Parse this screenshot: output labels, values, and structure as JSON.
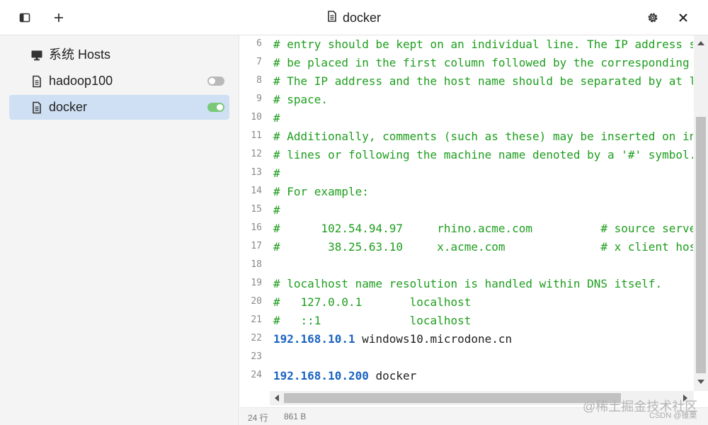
{
  "titlebar": {
    "title": "docker",
    "icons": {
      "sidebar_toggle": "sidebar-panel-icon",
      "add": "plus-icon",
      "doc": "document-icon",
      "settings": "gear-icon",
      "close": "close-icon"
    }
  },
  "sidebar": {
    "items": [
      {
        "label": "系统 Hosts",
        "icon": "monitor-icon",
        "toggle": null,
        "active": false
      },
      {
        "label": "hadoop100",
        "icon": "document-icon",
        "toggle": "off",
        "active": false
      },
      {
        "label": "docker",
        "icon": "document-icon",
        "toggle": "on",
        "active": true
      }
    ]
  },
  "editor": {
    "lines": [
      {
        "n": "6",
        "segments": [
          {
            "t": "# entry should be kept on an individual line. The IP address s",
            "c": "comment"
          }
        ]
      },
      {
        "n": "7",
        "segments": [
          {
            "t": "# be placed in the first column followed by the corresponding",
            "c": "comment"
          }
        ]
      },
      {
        "n": "8",
        "segments": [
          {
            "t": "# The IP address and the host name should be separated by at l",
            "c": "comment"
          }
        ]
      },
      {
        "n": "9",
        "segments": [
          {
            "t": "# space.",
            "c": "comment"
          }
        ]
      },
      {
        "n": "10",
        "segments": [
          {
            "t": "#",
            "c": "comment"
          }
        ]
      },
      {
        "n": "11",
        "segments": [
          {
            "t": "# Additionally, comments (such as these) may be inserted on in",
            "c": "comment"
          }
        ]
      },
      {
        "n": "12",
        "segments": [
          {
            "t": "# lines or following the machine name denoted by a '#' symbol.",
            "c": "comment"
          }
        ]
      },
      {
        "n": "13",
        "segments": [
          {
            "t": "#",
            "c": "comment"
          }
        ]
      },
      {
        "n": "14",
        "segments": [
          {
            "t": "# For example:",
            "c": "comment"
          }
        ]
      },
      {
        "n": "15",
        "segments": [
          {
            "t": "#",
            "c": "comment"
          }
        ]
      },
      {
        "n": "16",
        "segments": [
          {
            "t": "#      102.54.94.97     rhino.acme.com          # source serve",
            "c": "comment"
          }
        ]
      },
      {
        "n": "17",
        "segments": [
          {
            "t": "#       38.25.63.10     x.acme.com              # x client hos",
            "c": "comment"
          }
        ]
      },
      {
        "n": "18",
        "segments": []
      },
      {
        "n": "19",
        "segments": [
          {
            "t": "# localhost name resolution is handled within DNS itself.",
            "c": "comment"
          }
        ]
      },
      {
        "n": "20",
        "segments": [
          {
            "t": "#   127.0.0.1       localhost",
            "c": "comment"
          }
        ]
      },
      {
        "n": "21",
        "segments": [
          {
            "t": "#   ::1             localhost",
            "c": "comment"
          }
        ]
      },
      {
        "n": "22",
        "segments": [
          {
            "t": "192.168.10.1",
            "c": "ip"
          },
          {
            "t": " windows10.microdone.cn",
            "c": "host"
          }
        ]
      },
      {
        "n": "23",
        "segments": []
      },
      {
        "n": "24",
        "segments": [
          {
            "t": "192.168.10.200",
            "c": "ip"
          },
          {
            "t": " docker",
            "c": "host"
          }
        ]
      }
    ]
  },
  "statusbar": {
    "lines": "24 行",
    "size": "861 B"
  },
  "watermark": {
    "main": "@稀土掘金技术社区",
    "sub": "CSDN @锥栗"
  },
  "colors": {
    "comment": "#1e9e1e",
    "ip": "#1a63c2",
    "active_item": "#cfe0f4",
    "toggle_on": "#7ac97a",
    "toggle_off": "#b9b9b9"
  }
}
